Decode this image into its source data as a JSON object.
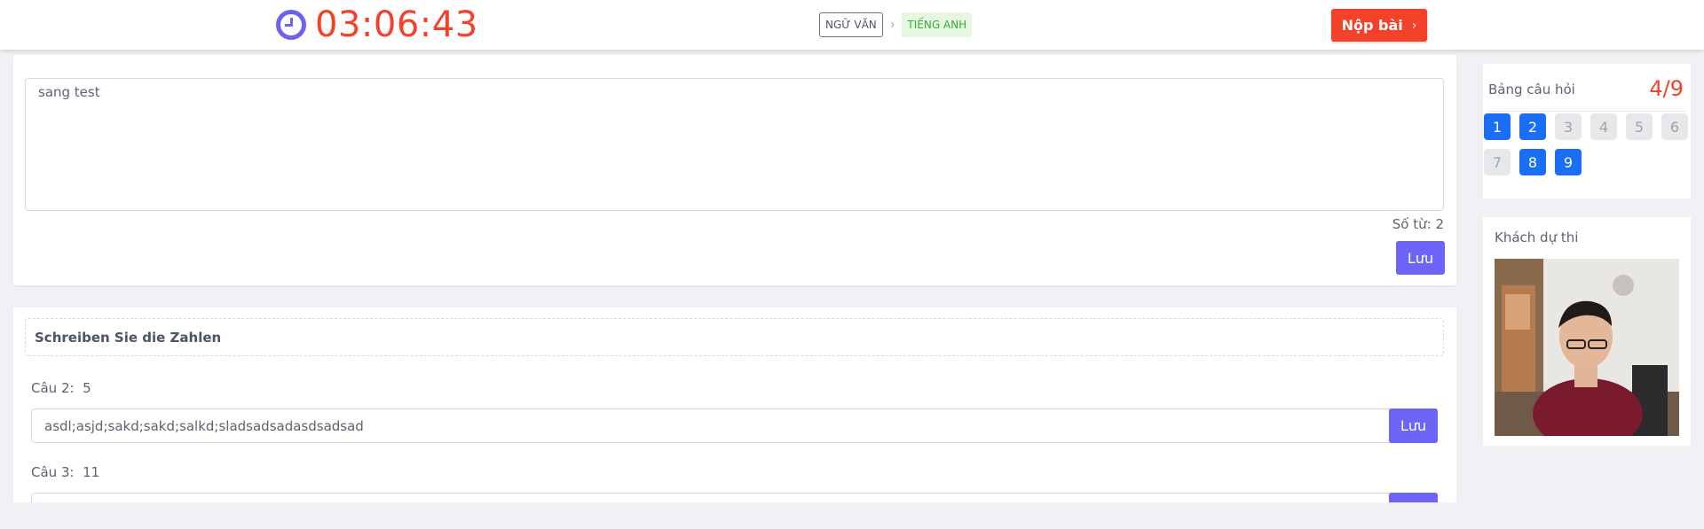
{
  "header": {
    "timer": "03:06:43",
    "breadcrumb_subject": "NGỮ VĂN",
    "breadcrumb_current": "TIẾNG ANH",
    "submit_label": "Nộp bài",
    "clock_icon": "clock-icon",
    "chevron_icon": "chevron-right-icon"
  },
  "question1": {
    "answer_text": "sang test",
    "word_count_label": "Số từ: 2",
    "save_label": "Lưu"
  },
  "section": {
    "title": "Schreiben Sie die Zahlen",
    "questions": [
      {
        "label": "Câu 2:",
        "number": "5",
        "answer": "asdl;asjd;sakd;sakd;salkd;sladsadsadasdsadsad",
        "save_label": "Lưu"
      },
      {
        "label": "Câu 3:",
        "number": "11",
        "answer": "",
        "save_label": "Lưu"
      }
    ]
  },
  "sidebar": {
    "question_board_title": "Bảng câu hỏi",
    "progress": "4/9",
    "questions": [
      {
        "n": "1",
        "done": true
      },
      {
        "n": "2",
        "done": true
      },
      {
        "n": "3",
        "done": false
      },
      {
        "n": "4",
        "done": false
      },
      {
        "n": "5",
        "done": false
      },
      {
        "n": "6",
        "done": false
      },
      {
        "n": "7",
        "done": false
      },
      {
        "n": "8",
        "done": true
      },
      {
        "n": "9",
        "done": true
      }
    ],
    "camera_title": "Khách dự thi"
  },
  "colors": {
    "accent_red": "#f4412a",
    "primary_blue": "#1a6ef5",
    "save_purple": "#6c63f7",
    "clock_purple": "#6c63e8",
    "tag_green": "#3aa83a"
  }
}
